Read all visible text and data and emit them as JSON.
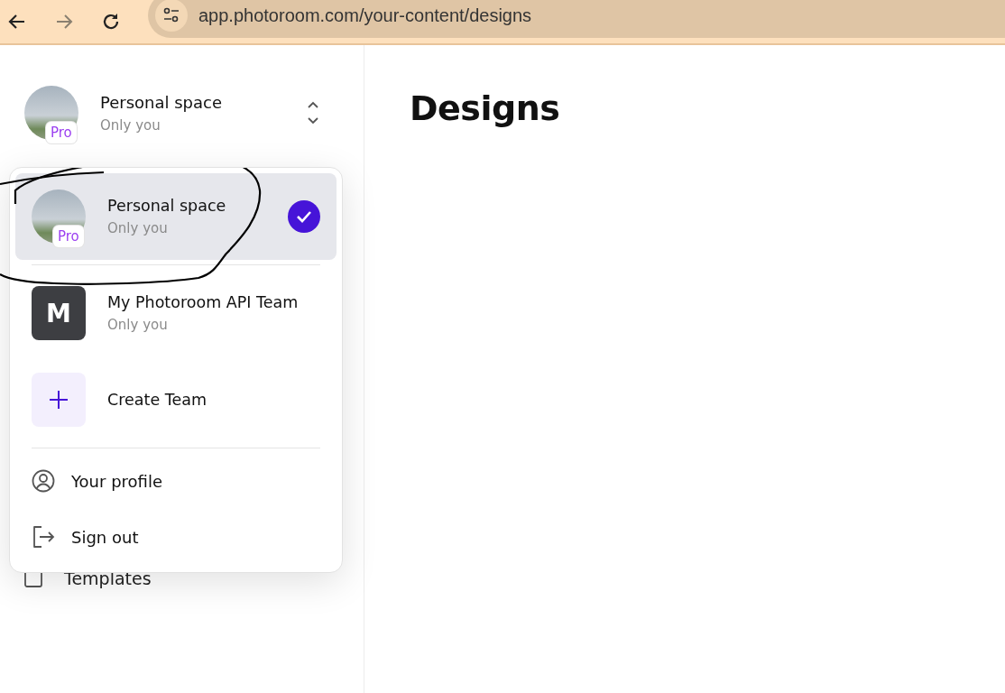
{
  "browser": {
    "url": "app.photoroom.com/your-content/designs"
  },
  "sidebar": {
    "space": {
      "name": "Personal space",
      "subtitle": "Only you",
      "badge": "Pro"
    },
    "items": [
      {
        "label": "Templates"
      }
    ]
  },
  "menu": {
    "spaces": [
      {
        "kind": "photo",
        "name": "Personal space",
        "subtitle": "Only you",
        "badge": "Pro",
        "selected": true
      },
      {
        "kind": "initial",
        "initial": "M",
        "name": "My Photoroom API Team",
        "subtitle": "Only you",
        "selected": false
      }
    ],
    "create": {
      "label": "Create Team"
    },
    "actions": [
      {
        "kind": "profile",
        "label": "Your profile"
      },
      {
        "kind": "signout",
        "label": "Sign out"
      }
    ]
  },
  "main": {
    "title": "Designs"
  }
}
